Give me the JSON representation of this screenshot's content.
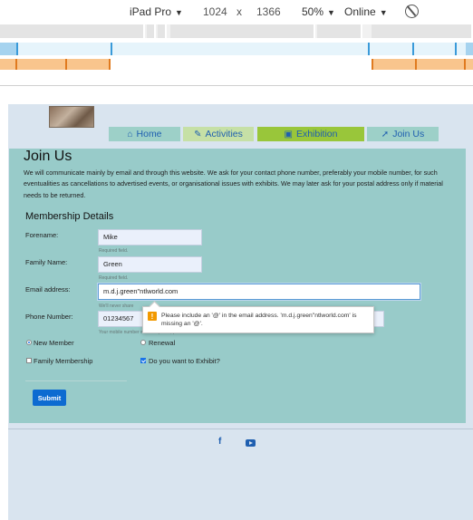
{
  "devtools": {
    "device": "iPad Pro",
    "width": "1024",
    "times": "x",
    "height": "1366",
    "zoom": "50%",
    "throttle": "Online",
    "caret": "▼"
  },
  "nav": {
    "items": [
      {
        "label": "Home",
        "icon": "home-icon",
        "glyph": "⌂"
      },
      {
        "label": "Activities",
        "icon": "brush-icon",
        "glyph": "✎"
      },
      {
        "label": "Exhibition",
        "icon": "image-icon",
        "glyph": "▣"
      },
      {
        "label": "Join Us",
        "icon": "rocket-icon",
        "glyph": "➚"
      }
    ]
  },
  "join": {
    "title": "Join Us",
    "intro": "We will communicate mainly by email and through this website. We ask for your contact phone number, preferably your mobile number, for such eventualities as cancellations to advertised events, or organisational issues with exhibits. We may later ask for your postal address only if material needs to be returned.",
    "section_title": "Membership Details"
  },
  "form": {
    "forename_label": "Forename:",
    "forename_value": "Mike",
    "forename_help": "Required field.",
    "family_label": "Family Name:",
    "family_value": "Green",
    "family_help": "Required field.",
    "email_label": "Email address:",
    "email_value": "m.d.j.green\"ntlworld.com",
    "email_help": "We'll never share",
    "phone_label": "Phone Number:",
    "phone_value": "01234567",
    "phone_help": "Your mobile number without spaces, please.",
    "new_member_label": "New Member",
    "renewal_label": "Renewal",
    "family_membership_label": "Family Membership",
    "exhibit_label": "Do you want to Exhibit?",
    "submit_label": "Submit"
  },
  "tooltip": {
    "icon": "!",
    "text": "Please include an '@' in the email address. 'm.d.j.green\"ntlworld.com' is missing an '@'."
  },
  "footer": {
    "facebook_glyph": "f"
  },
  "colors": {
    "panel": "#98cbc9",
    "nav_active": "#99c63a",
    "link": "#1f5fb0",
    "submit": "#0d6bd1",
    "warning": "#f29900"
  }
}
